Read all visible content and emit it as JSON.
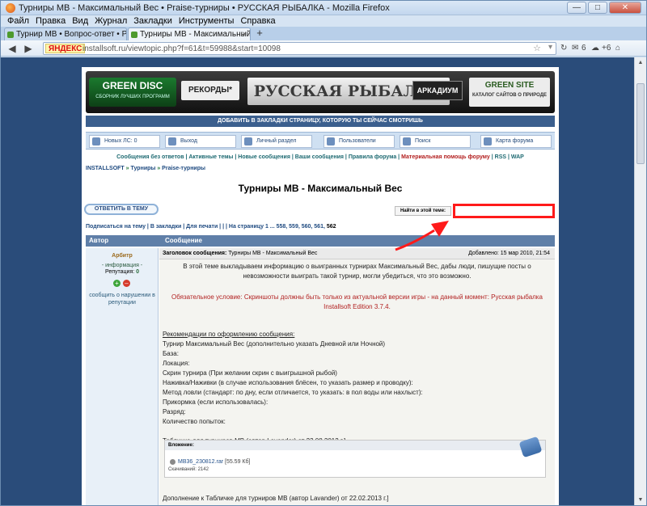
{
  "window": {
    "title": "Турниры МВ - Максимальный Вес • Praise-турниры • РУССКАЯ РЫБАЛКА - Mozilla Firefox",
    "min": "—",
    "max": "□",
    "close": "✕"
  },
  "menu": [
    "Файл",
    "Правка",
    "Вид",
    "Журнал",
    "Закладки",
    "Инструменты",
    "Справка"
  ],
  "tabs": [
    {
      "label": "Турнир МВ • Вопрос-ответ • РУССКАЯ ..."
    },
    {
      "label": "Турниры МВ - Максимальный Вес • Prai..."
    }
  ],
  "newtab_label": "+",
  "tab_close": "×",
  "nav": {
    "yandex": "ЯНДЕКС",
    "url": "installsoft.ru/viewtopic.php?f=61&t=59988&start=10098",
    "weather": "+6",
    "mail": "6",
    "star": "☆",
    "go": "▾"
  },
  "banner": {
    "greendisc": "GREEN DISC",
    "greendisc_sub": "СБОРНИК ЛУЧШИХ ПРОГРАММ",
    "records": "РЕКОРДЫ*",
    "fishing": "РУССКАЯ РЫБАЛКА",
    "arcadium": "АРКАДИУМ",
    "greensite": "GREEN SITE",
    "greensite_sub": "КАТАЛОГ САЙТОВ О ПРИРОДЕ"
  },
  "bookmark_text": "ДОБАВИТЬ В ЗАКЛАДКИ СТРАНИЦУ, КОТОРУЮ ТЫ СЕЙЧАС СМОТРИШЬ",
  "forum_nav": [
    "Новых ЛС: 0",
    "Выход",
    "Личный раздел",
    "Пользователи",
    "Поиск",
    "Карта форума"
  ],
  "links": {
    "a": "Сообщения без ответов",
    "b": "Активные темы",
    "c": "Новые сообщения",
    "d": "Ваши сообщения",
    "e": "Правила форума",
    "f": "Материальная помощь форуму",
    "g": "RSS",
    "h": "WAP",
    "sep": " | "
  },
  "breadcrumb": {
    "a": "INSTALLSOFT",
    "b": "Турниры",
    "c": "Praise-турниры",
    "sep": " » "
  },
  "topic_title": "Турниры МВ - Максимальный Вес",
  "reply_button": "ОТВЕТИТЬ В ТЕМУ",
  "search_label": "Найти в этой теме:",
  "pager": {
    "left": "Подписаться на тему | В закладки | Для печати | | | На страницу",
    "pages": "1 ... 558, 559, 560, 561,",
    "current": "562"
  },
  "table_head": {
    "author": "Автор",
    "message": "Сообщение"
  },
  "author": {
    "name": "Арбитр",
    "info": "- информация -",
    "rep_label": "Репутация:",
    "rep_value": "0",
    "plus": "+",
    "minus": "–",
    "report": "сообщить о нарушении в репутации"
  },
  "post": {
    "subject_label": "Заголовок сообщения:",
    "subject": "Турниры МВ - Максимальный Вес",
    "added": "Добавлено: 15 мар 2010, 21:54",
    "intro": "В этой теме выкладываем информацию о выигранных турнирах Максимальный Вес, дабы люди, пишущие посты о невозможности выиграть такой турнир, могли убедиться, что это возможно.",
    "warning": "Обязательное условие: Скриншоты должны быть только из актуальной версии игры - на данный момент: Русская рыбалка Installsoft Edition 3.7.4.",
    "rec_title": "Рекомендации по оформлению сообщения:",
    "lines": [
      "Турнир Максимальный Вес (дополнительно указать Дневной или Ночной)",
      "База:",
      "Локация:",
      "Скрин турнира (При желании скрин с выигрышной рыбой)",
      "Наживка/Наживки (в случае использования блёсен, то указать размер и проводку):",
      "Метод ловли (стандарт: по дну, если отличается, то указать: в пол воды или нахлыст):",
      "Прикормка (если использовалась):",
      "Разряд:",
      "Количество попыток:"
    ],
    "table_line": "Табличка для турниров МВ (автор Lavander) от 23.08.2012 г.]",
    "attach_head": "Вложение:",
    "file": "MB36_230812.rar",
    "file_size": "[55.59 Кб]",
    "downloads": "Скачиваний: 2142",
    "addon": "Дополнение к Табличке для турниров МВ (автор Lavander) от 22.02.2013 г.]"
  },
  "colors": {
    "highlight": "#ff1a1a",
    "page_bg": "#2a4c7a"
  }
}
